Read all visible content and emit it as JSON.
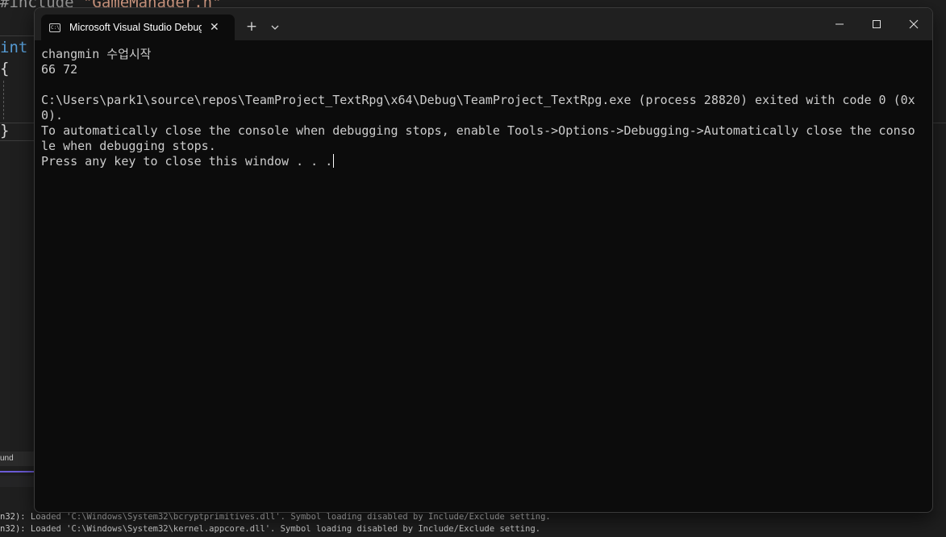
{
  "ide": {
    "code": {
      "include_kw": "#include ",
      "include_str": "\"GameManager.h\"",
      "int_kw": "int",
      "open_brace": "{",
      "close_brace": "}"
    },
    "found_label": "und",
    "output_lines": [
      "n32): Loaded 'C:\\Windows\\System32\\bcryptprimitives.dll'. Symbol loading disabled by Include/Exclude setting.",
      "n32): Loaded 'C:\\Windows\\System32\\kernel.appcore.dll'. Symbol loading disabled by Include/Exclude setting."
    ]
  },
  "terminal": {
    "tab_title": "Microsoft Visual Studio Debug",
    "tab_icon": "console-icon",
    "new_tab_label": "+",
    "console_lines": [
      "changmin 수업시작",
      "66 72",
      "",
      "C:\\Users\\park1\\source\\repos\\TeamProject_TextRpg\\x64\\Debug\\TeamProject_TextRpg.exe (process 28820) exited with code 0 (0x",
      "0).",
      "To automatically close the console when debugging stops, enable Tools->Options->Debugging->Automatically close the conso",
      "le when debugging stops.",
      "Press any key to close this window . . ."
    ]
  },
  "colors": {
    "terminal_bg": "#0c0c0c",
    "titlebar_bg": "#202020",
    "console_text": "#cccccc",
    "ide_accent": "#6b5bd6"
  }
}
